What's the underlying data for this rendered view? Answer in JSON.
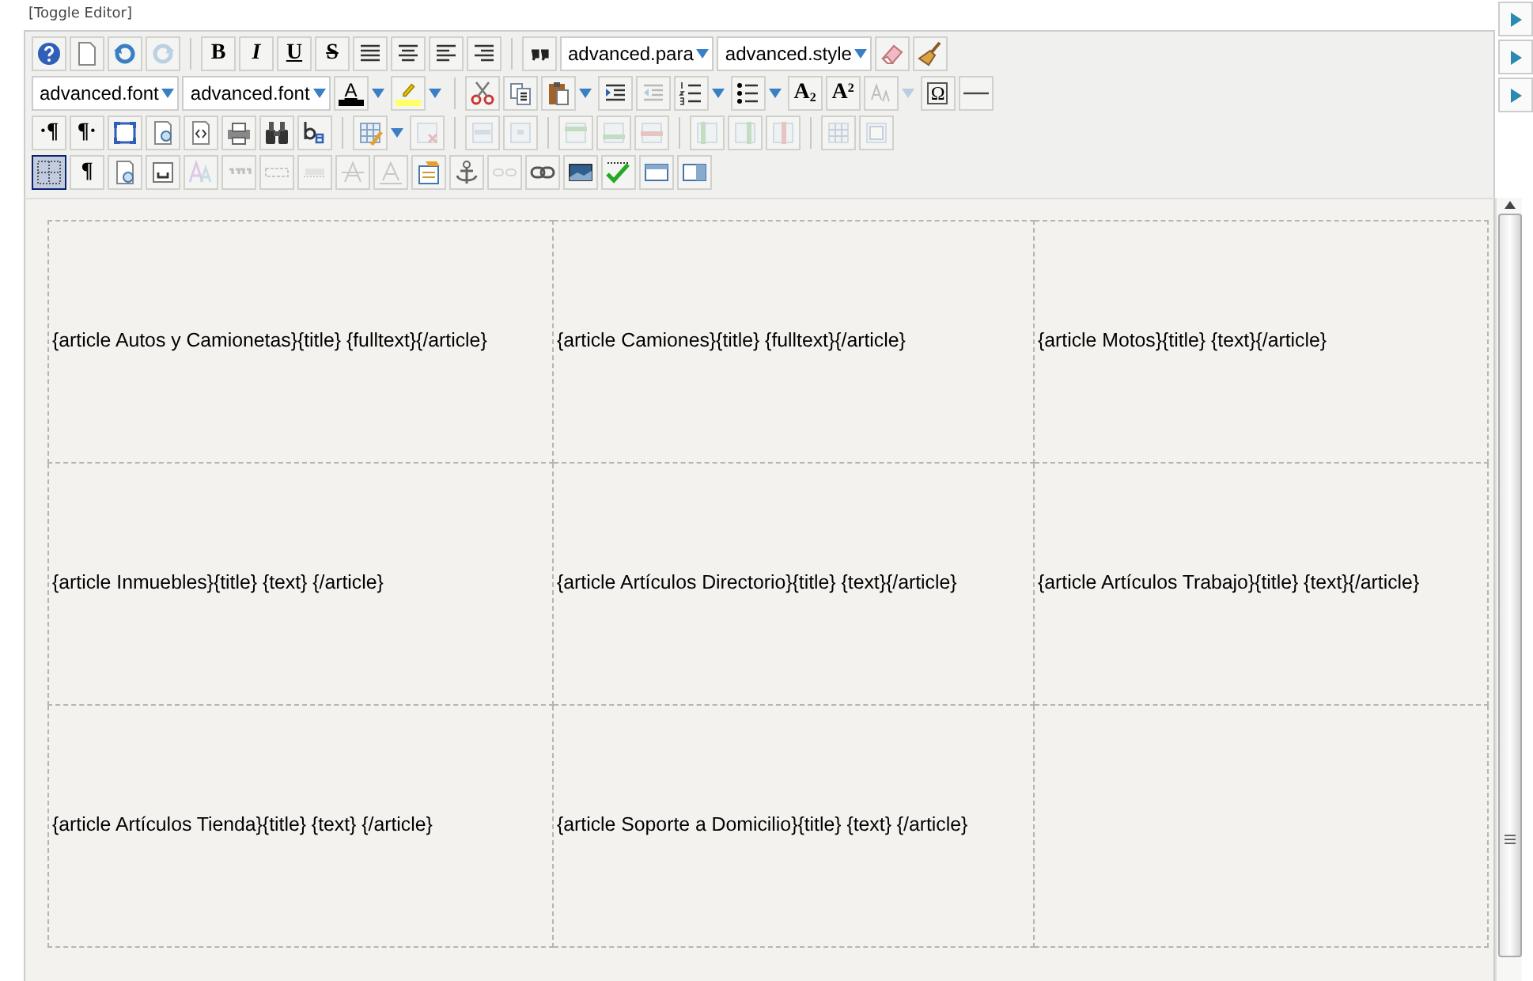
{
  "toggle_link": "[Toggle Editor]",
  "toolbar_rows": [
    [
      {
        "kind": "button",
        "disabled": false,
        "selected": false
      },
      {
        "kind": "button",
        "disabled": false,
        "selected": false
      },
      {
        "kind": "button",
        "disabled": false,
        "selected": false
      },
      {
        "kind": "button",
        "disabled": true,
        "selected": false
      },
      {
        "kind": "separator"
      },
      {
        "kind": "glyph-bold",
        "glyph": "B",
        "disabled": false,
        "selected": false
      },
      {
        "kind": "glyph-italic",
        "glyph": "I",
        "disabled": false,
        "selected": false
      },
      {
        "kind": "glyph-underline",
        "glyph": "U",
        "disabled": false,
        "selected": false
      },
      {
        "kind": "glyph-strike",
        "glyph": "S",
        "disabled": false,
        "selected": false
      },
      {
        "kind": "button",
        "disabled": false,
        "selected": false
      },
      {
        "kind": "button",
        "disabled": false,
        "selected": false
      },
      {
        "kind": "button",
        "disabled": false,
        "selected": false
      },
      {
        "kind": "button",
        "disabled": false,
        "selected": false
      },
      {
        "kind": "separator"
      },
      {
        "kind": "button",
        "disabled": false,
        "selected": false
      },
      {
        "kind": "select",
        "value": "advanced.para"
      },
      {
        "kind": "select",
        "value": "advanced.style"
      },
      {
        "kind": "button",
        "disabled": false,
        "selected": false
      },
      {
        "kind": "button",
        "disabled": false,
        "selected": false
      }
    ],
    [
      {
        "kind": "select",
        "value": "advanced.font"
      },
      {
        "kind": "select",
        "value": "advanced.font"
      },
      {
        "kind": "color",
        "glyph": "A",
        "color": "#000000"
      },
      {
        "kind": "color",
        "color": "#ffff66"
      },
      {
        "kind": "separator"
      },
      {
        "kind": "button",
        "disabled": false,
        "selected": false
      },
      {
        "kind": "button",
        "disabled": false,
        "selected": false
      },
      {
        "kind": "split",
        "disabled": false
      },
      {
        "kind": "button",
        "disabled": false,
        "selected": false
      },
      {
        "kind": "button",
        "disabled": true,
        "selected": false
      },
      {
        "kind": "split",
        "disabled": false
      },
      {
        "kind": "split",
        "disabled": false
      },
      {
        "kind": "glyph-bold",
        "glyph": "A$_{2}$",
        "disabled": false,
        "selected": false
      },
      {
        "kind": "glyph-bold",
        "glyph": "A$^{2}$",
        "disabled": false,
        "selected": false
      },
      {
        "kind": "split",
        "disabled": true
      },
      {
        "kind": "glyph-boxed",
        "glyph": "Ω",
        "disabled": false,
        "selected": false
      },
      {
        "kind": "button",
        "disabled": false,
        "selected": false
      }
    ],
    [
      {
        "kind": "glyph-bold",
        "glyph": "·¶",
        "disabled": false,
        "selected": false
      },
      {
        "kind": "glyph-bold",
        "glyph": "¶·",
        "disabled": false,
        "selected": false
      },
      {
        "kind": "button",
        "disabled": false,
        "selected": false
      },
      {
        "kind": "button",
        "disabled": false,
        "selected": false
      },
      {
        "kind": "button",
        "disabled": false,
        "selected": false
      },
      {
        "kind": "button",
        "disabled": false,
        "selected": false
      },
      {
        "kind": "button",
        "disabled": false,
        "selected": false
      },
      {
        "kind": "button",
        "disabled": false,
        "selected": false
      },
      {
        "kind": "separator"
      },
      {
        "kind": "split",
        "disabled": false
      },
      {
        "kind": "button",
        "disabled": true,
        "selected": false
      },
      {
        "kind": "separator"
      },
      {
        "kind": "button",
        "disabled": true,
        "selected": false
      },
      {
        "kind": "button",
        "disabled": true,
        "selected": false
      },
      {
        "kind": "separator"
      },
      {
        "kind": "button",
        "disabled": true,
        "selected": false
      },
      {
        "kind": "button",
        "disabled": true,
        "selected": false
      },
      {
        "kind": "button",
        "disabled": true,
        "selected": false
      },
      {
        "kind": "separator"
      },
      {
        "kind": "button",
        "disabled": true,
        "selected": false
      },
      {
        "kind": "button",
        "disabled": true,
        "selected": false
      },
      {
        "kind": "button",
        "disabled": true,
        "selected": false
      },
      {
        "kind": "separator"
      },
      {
        "kind": "button",
        "disabled": true,
        "selected": false
      },
      {
        "kind": "button",
        "disabled": true,
        "selected": false
      }
    ],
    [
      {
        "kind": "button",
        "disabled": false,
        "selected": true
      },
      {
        "kind": "glyph-bold",
        "glyph": "¶",
        "disabled": false,
        "selected": false
      },
      {
        "kind": "button",
        "disabled": false,
        "selected": false
      },
      {
        "kind": "button",
        "disabled": false,
        "selected": false
      },
      {
        "kind": "button",
        "disabled": true,
        "selected": false
      },
      {
        "kind": "button",
        "disabled": true,
        "selected": false
      },
      {
        "kind": "button",
        "disabled": true,
        "selected": false
      },
      {
        "kind": "button",
        "disabled": true,
        "selected": false
      },
      {
        "kind": "button",
        "disabled": true,
        "selected": false
      },
      {
        "kind": "button",
        "disabled": true,
        "selected": false
      },
      {
        "kind": "button",
        "disabled": false,
        "selected": false
      },
      {
        "kind": "button",
        "disabled": false,
        "selected": false
      },
      {
        "kind": "button",
        "disabled": true,
        "selected": false
      },
      {
        "kind": "button",
        "disabled": false,
        "selected": false
      },
      {
        "kind": "button",
        "disabled": false,
        "selected": false
      },
      {
        "kind": "button",
        "disabled": false,
        "selected": false
      },
      {
        "kind": "button",
        "disabled": false,
        "selected": false
      },
      {
        "kind": "button",
        "disabled": false,
        "selected": false
      }
    ]
  ],
  "table_rows": [
    [
      "{article Autos y Camionetas}{title} {fulltext}{/article}",
      "{article Camiones}{title} {fulltext}{/article}",
      "{article Motos}{title} {text}{/article}"
    ],
    [
      "{article Inmuebles}{title} {text} {/article}",
      "{article Artículos Directorio}{title} {text}{/article}",
      "{article Artículos Trabajo}{title} {text}{/article}"
    ],
    [
      "{article Artículos Tienda}{title} {text} {/article}",
      "{article Soporte a Domicilio}{title} {text} {/article}"
    ]
  ],
  "side_buttons": [
    {
      "kind": "expand"
    },
    {
      "kind": "expand"
    },
    {
      "kind": "expand"
    }
  ]
}
